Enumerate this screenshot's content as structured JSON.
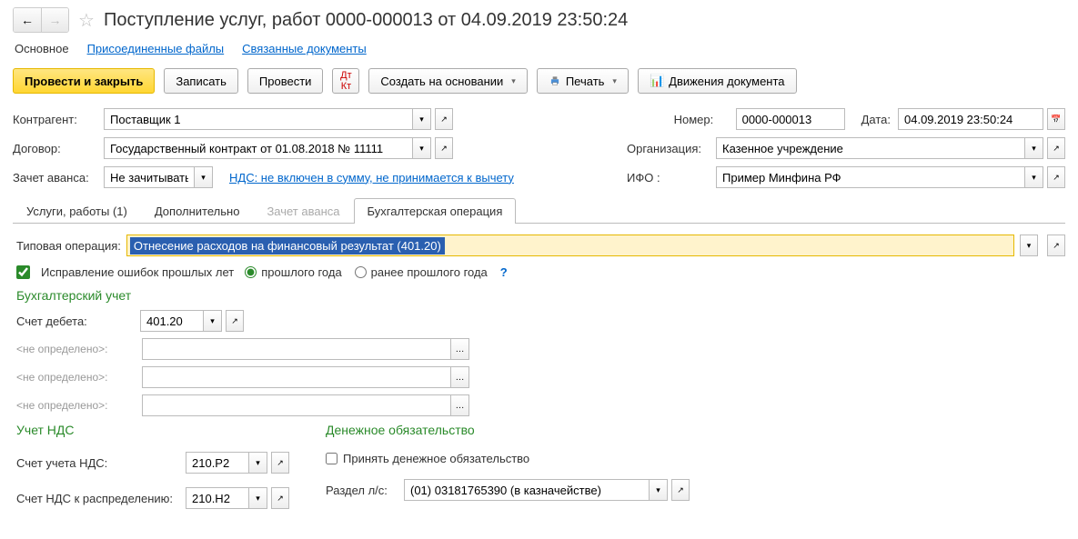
{
  "header": {
    "title": "Поступление услуг, работ 0000-000013 от 04.09.2019 23:50:24"
  },
  "sectionTabs": {
    "main": "Основное",
    "files": "Присоединенные файлы",
    "related": "Связанные документы"
  },
  "toolbar": {
    "postClose": "Провести и закрыть",
    "save": "Записать",
    "post": "Провести",
    "createFrom": "Создать на основании",
    "print": "Печать",
    "movements": "Движения документа"
  },
  "labels": {
    "counterparty": "Контрагент:",
    "contract": "Договор:",
    "advance": "Зачет аванса:",
    "number": "Номер:",
    "date": "Дата:",
    "org": "Организация:",
    "ifo": "ИФО :"
  },
  "fields": {
    "counterparty": "Поставщик 1",
    "contract": "Государственный контракт от 01.08.2018 № 11111",
    "advance": "Не зачитывать",
    "vatLink": "НДС: не включен в сумму, не принимается к вычету",
    "number": "0000-000013",
    "date": "04.09.2019 23:50:24",
    "org": "Казенное учреждение",
    "ifo": "Пример Минфина РФ"
  },
  "tabs": {
    "services": "Услуги, работы (1)",
    "extra": "Дополнительно",
    "advance": "Зачет аванса",
    "acc": "Бухгалтерская операция"
  },
  "operation": {
    "label": "Типовая операция:",
    "value": "Отнесение расходов на финансовый результат (401.20)",
    "fixLabel": "Исправление ошибок прошлых лет",
    "radio1": "прошлого года",
    "radio2": "ранее прошлого года"
  },
  "accounting": {
    "header": "Бухгалтерский учет",
    "debitLabel": "Счет дебета:",
    "debitValue": "401.20",
    "undef": "<не определено>:"
  },
  "vat": {
    "header": "Учет НДС",
    "accLabel": "Счет учета НДС:",
    "accValue": "210.Р2",
    "distLabel": "Счет НДС к распределению:",
    "distValue": "210.Н2"
  },
  "obligation": {
    "header": "Денежное обязательство",
    "acceptLabel": "Принять денежное обязательство",
    "sectionLabel": "Раздел л/с:",
    "sectionValue": "(01) 03181765390 (в казначействе)"
  }
}
